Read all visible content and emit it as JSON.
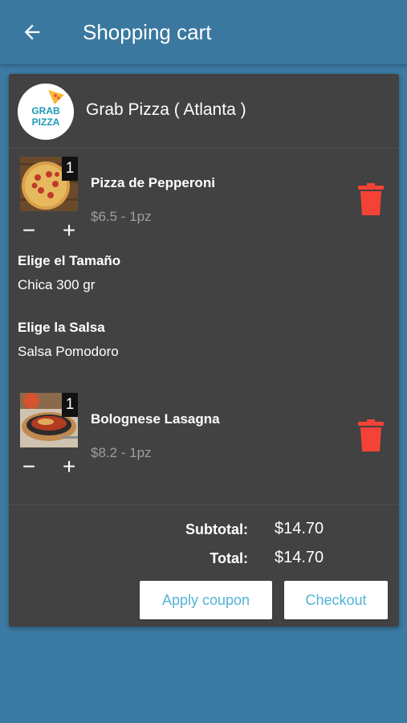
{
  "appbar": {
    "title": "Shopping cart",
    "back_icon": "arrow-left-icon"
  },
  "store": {
    "name": "Grab Pizza ( Atlanta )",
    "logo_text": "GRAB PIZZA",
    "logo_line1": "GRAB",
    "logo_line2": "PIZZA"
  },
  "items": [
    {
      "name": "Pizza de Pepperoni",
      "price": "$6.5 - 1pz",
      "quantity": "1",
      "minus": "−",
      "plus": "+",
      "options": [
        {
          "label": "Elige el Tamaño",
          "value": "Chica 300 gr"
        },
        {
          "label": "Elige la Salsa",
          "value": "Salsa Pomodoro"
        }
      ]
    },
    {
      "name": "Bolognese Lasagna",
      "price": "$8.2 - 1pz",
      "quantity": "1",
      "minus": "−",
      "plus": "+"
    }
  ],
  "summary": {
    "subtotal_label": "Subtotal:",
    "subtotal_value": "$14.70",
    "total_label": "Total:",
    "total_value": "$14.70"
  },
  "actions": {
    "apply_coupon": "Apply coupon",
    "checkout": "Checkout"
  },
  "colors": {
    "appbar": "#3a78a0",
    "card": "#424242",
    "accent": "#52b4d6",
    "delete": "#f44336"
  }
}
